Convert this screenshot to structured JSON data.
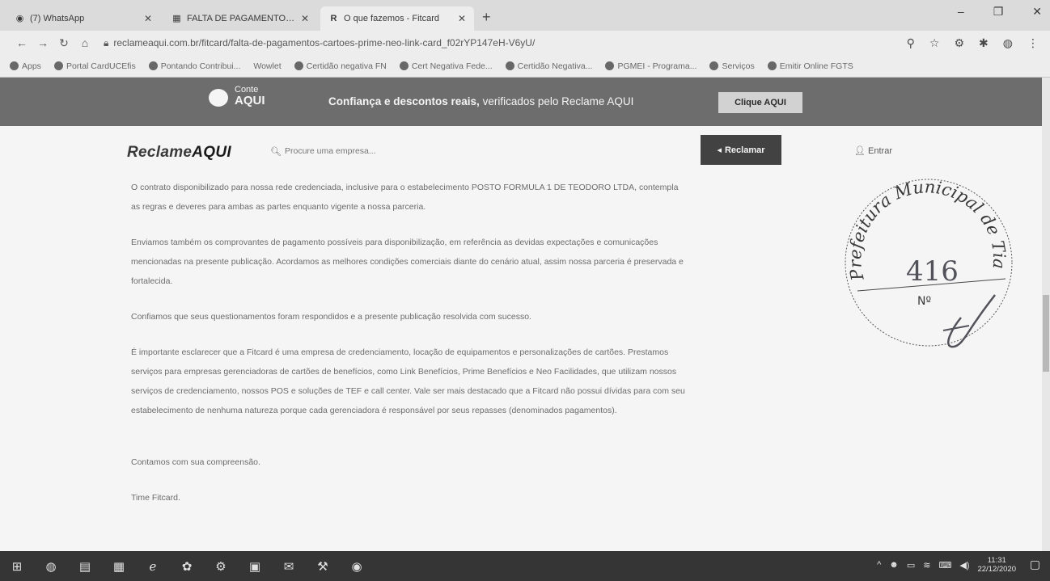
{
  "browser": {
    "tabs": [
      {
        "icon": "whatsapp-icon",
        "title": "(7) WhatsApp",
        "active": false
      },
      {
        "icon": "document-icon",
        "title": "FALTA DE PAGAMENTOS - CART",
        "active": false
      },
      {
        "icon": "ra-icon",
        "title": "O que fazemos - Fitcard",
        "active": true
      }
    ],
    "url": "reclameaqui.com.br/fitcard/falta-de-pagamentos-cartoes-prime-neo-link-card_f02rYP147eH-V6yU/",
    "bookmarks": [
      "Apps",
      "Portal CardUCEfis",
      "Pontando Contribui...",
      "Wowlet",
      "Certidão negativa FN",
      "Cert Negativa Fede...",
      "Certidão Negativa...",
      "PGMEI - Programa...",
      "Serviços",
      "Emitir Online FGTS"
    ]
  },
  "banner": {
    "logo_top": "Conte",
    "logo_bottom": "AQUI",
    "message_bold": "Confiança e descontos reais,",
    "message_rest": " verificados pelo Reclame AQUI",
    "button": "Clique AQUI"
  },
  "header": {
    "brand_part1": "Reclame",
    "brand_part2": "AQUI",
    "search_placeholder": "Procure uma empresa...",
    "reclamar": "Reclamar",
    "login": "Entrar"
  },
  "article": {
    "p1": "O contrato disponibilizado para nossa rede credenciada, inclusive para o estabelecimento POSTO FORMULA 1 DE TEODORO LTDA, contempla as regras e deveres para ambas as partes enquanto vigente a nossa parceria.",
    "p2": "Enviamos também os comprovantes de pagamento possíveis para disponibilização, em referência as devidas expectações e comunicações mencionadas na presente publicação. Acordamos as melhores condições comerciais diante do cenário atual, assim nossa parceria é preservada e fortalecida.",
    "p3": "Confiamos que seus questionamentos foram respondidos e a presente publicação resolvida com sucesso.",
    "p4": "É importante esclarecer que a Fitcard é uma empresa de credenciamento, locação de equipamentos e personalizações de cartões. Prestamos serviços para empresas gerenciadoras de cartões de benefícios, como Link Benefícios, Prime Benefícios e Neo Facilidades, que utilizam nossos serviços de credenciamento, nossos POS e soluções de TEF e call center. Vale ser mais destacado que a Fitcard não possui dívidas para com seu estabelecimento de nenhuma natureza porque cada gerenciadora é responsável por seus repasses (denominados pagamentos).",
    "p5": "Contamos com sua compreensão.",
    "p6": "Time Fitcard."
  },
  "stamp": {
    "ring_text": "Prefeitura Municipal de Tianguá",
    "number": "416",
    "label": "Nº"
  },
  "taskbar": {
    "time": "11:31",
    "date": "22/12/2020"
  }
}
